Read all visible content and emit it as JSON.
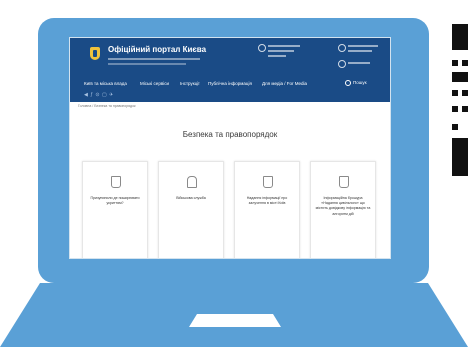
{
  "header": {
    "site_title": "Офіційний портал Києва",
    "social": "◀ ƒ ⊙ ▢ ✈"
  },
  "nav": {
    "items": [
      "Київ та міська влада",
      "Міські сервіси",
      "Інструкції",
      "Публічна інформація",
      "Для медіа / For Media"
    ],
    "search_label": "Пошук"
  },
  "breadcrumb": "Головна / Безпека та правопорядок",
  "page_title": "Безпека та правопорядок",
  "cards": [
    {
      "label": "Призупинили де поширювати укриттям?",
      "icon": "kyiv-crest-icon"
    },
    {
      "label": "Військова служба",
      "icon": "soldier-icon"
    },
    {
      "label": "Надання інформації про залучення в місті Київ",
      "icon": "kyiv-crest-icon"
    },
    {
      "label": "Інформаційна брошура «Надання цивільного» що містить довідкову інформацію та алгоритм дій",
      "icon": "kyiv-crest-icon"
    }
  ],
  "colors": {
    "laptop": "#5aa0d6",
    "header": "#1a4b86",
    "crest": "#f1c33c"
  }
}
